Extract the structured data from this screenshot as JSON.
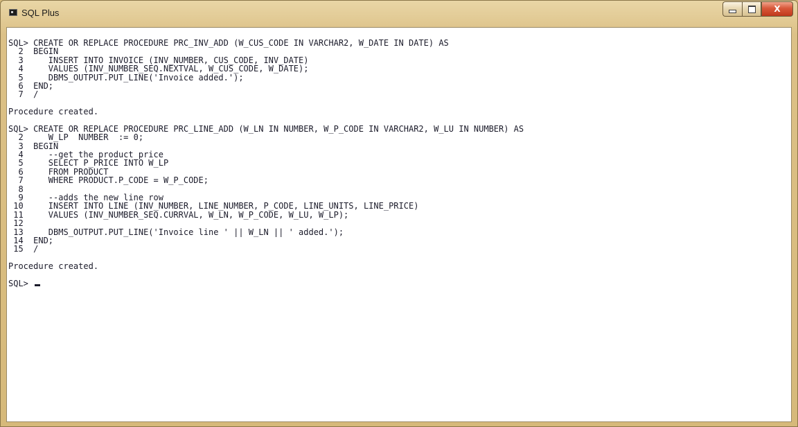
{
  "window": {
    "title": "SQL Plus",
    "close_glyph": "X"
  },
  "console": {
    "lines": [
      "SQL> CREATE OR REPLACE PROCEDURE PRC_INV_ADD (W_CUS_CODE IN VARCHAR2, W_DATE IN DATE) AS",
      "  2  BEGIN",
      "  3     INSERT INTO INVOICE (INV_NUMBER, CUS_CODE, INV_DATE)",
      "  4     VALUES (INV_NUMBER_SEQ.NEXTVAL, W_CUS_CODE, W_DATE);",
      "  5     DBMS_OUTPUT.PUT_LINE('Invoice added.');",
      "  6  END;",
      "  7  /",
      "",
      "Procedure created.",
      "",
      "SQL> CREATE OR REPLACE PROCEDURE PRC_LINE_ADD (W_LN IN NUMBER, W_P_CODE IN VARCHAR2, W_LU IN NUMBER) AS",
      "  2     W_LP  NUMBER  := 0;",
      "  3  BEGIN",
      "  4     --get the product price",
      "  5     SELECT P_PRICE INTO W_LP",
      "  6     FROM PRODUCT",
      "  7     WHERE PRODUCT.P_CODE = W_P_CODE;",
      "  8",
      "  9     --adds the new line row",
      " 10     INSERT INTO LINE (INV_NUMBER, LINE_NUMBER, P_CODE, LINE_UNITS, LINE_PRICE)",
      " 11     VALUES (INV_NUMBER_SEQ.CURRVAL, W_LN, W_P_CODE, W_LU, W_LP);",
      " 12",
      " 13     DBMS_OUTPUT.PUT_LINE('Invoice line ' || W_LN || ' added.');",
      " 14  END;",
      " 15  /",
      "",
      "Procedure created.",
      ""
    ],
    "prompt": "SQL> "
  }
}
